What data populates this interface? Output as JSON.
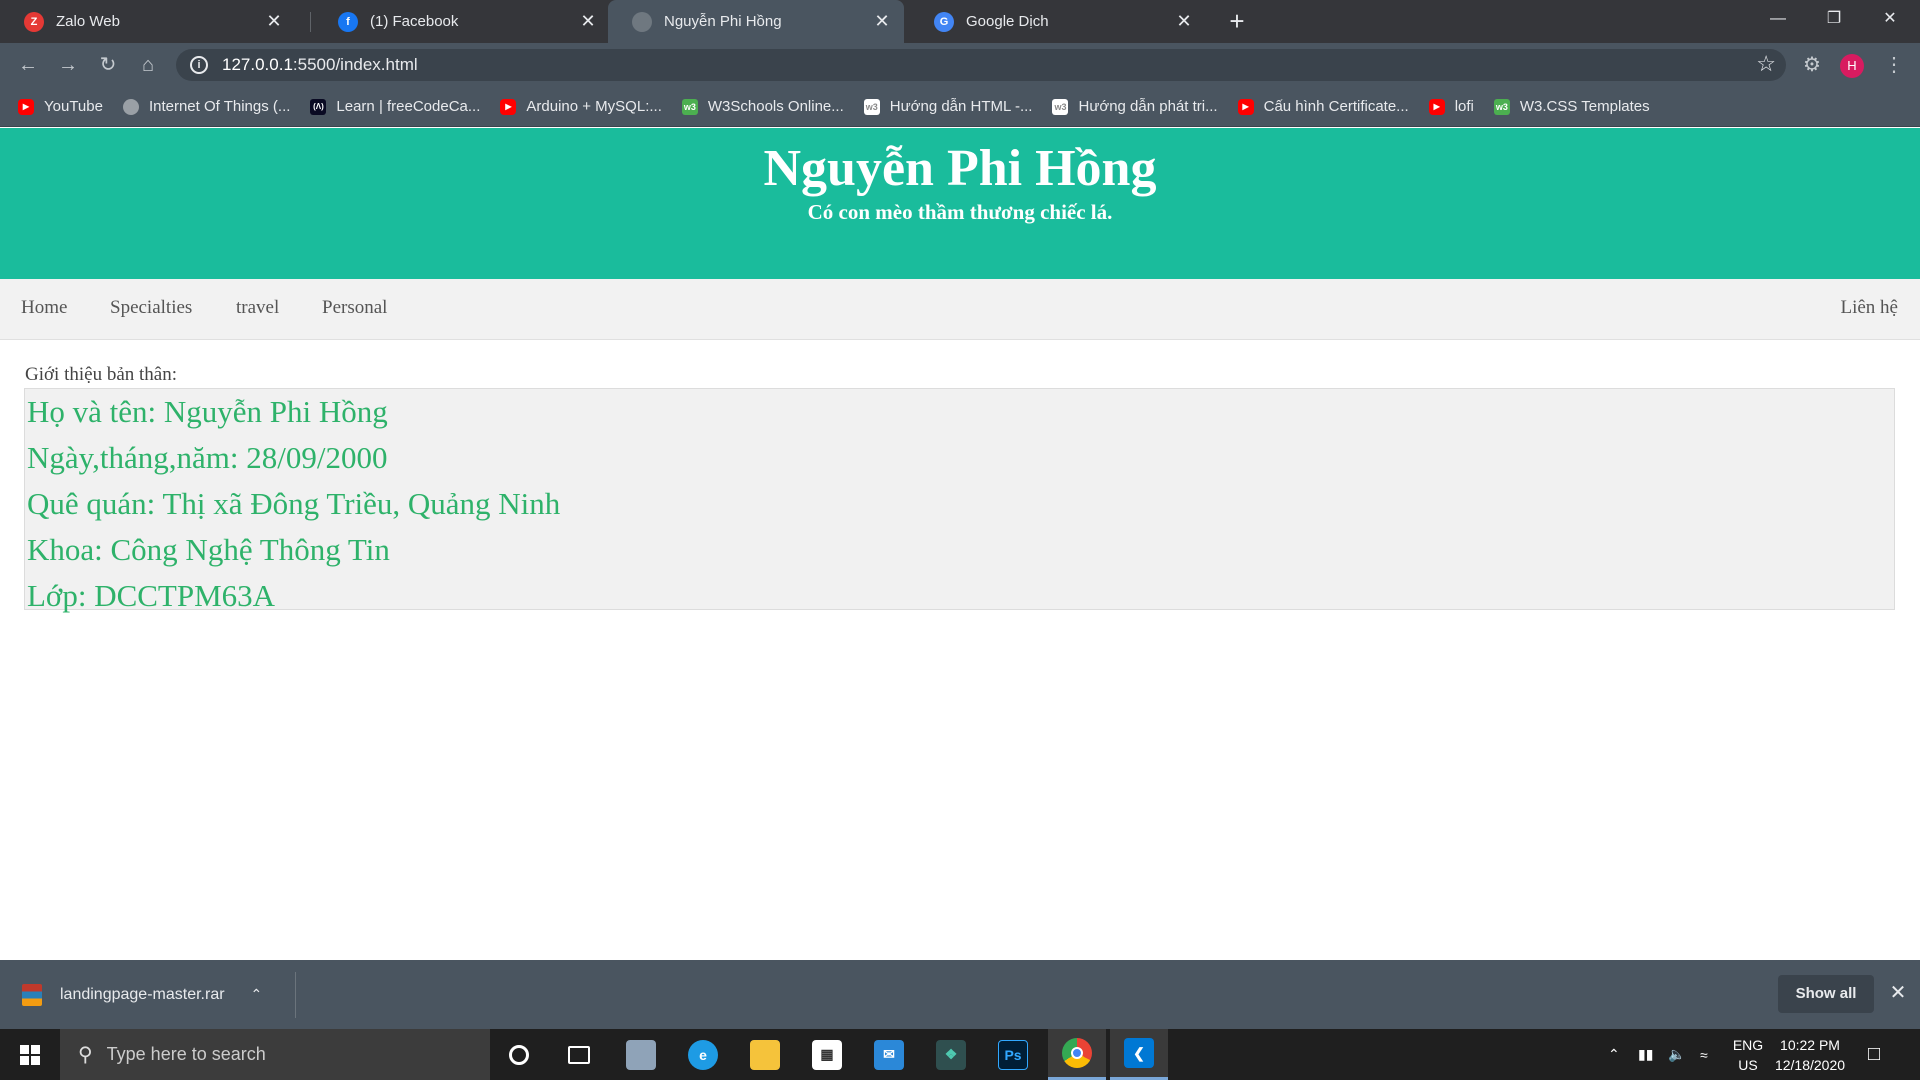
{
  "browser": {
    "tabs": [
      {
        "title": "Zalo Web",
        "icon": "zalo-icon",
        "color": "#e53935",
        "glyph": "Z"
      },
      {
        "title": "(1) Facebook",
        "icon": "facebook-icon",
        "color": "#1877f2",
        "glyph": "f"
      },
      {
        "title": "Nguyễn Phi Hồng",
        "icon": "globe-icon",
        "color": "#6f7880",
        "glyph": ""
      },
      {
        "title": "Google Dịch",
        "icon": "google-translate-icon",
        "color": "#4285f4",
        "glyph": "G"
      }
    ],
    "active_tab": 2,
    "url_host": "127.0.0.1",
    "url_rest": ":5500/index.html",
    "profile_initial": "H",
    "bookmarks": [
      {
        "label": "YouTube",
        "icon": "youtube-icon",
        "color": "#ff0000"
      },
      {
        "label": "Internet Of Things (...",
        "icon": "globe-icon",
        "color": "#9aa0a6"
      },
      {
        "label": "Learn | freeCodeCa...",
        "icon": "freecodecamp-icon",
        "color": "#0a0a23"
      },
      {
        "label": "Arduino + MySQL:...",
        "icon": "youtube-icon",
        "color": "#ff0000"
      },
      {
        "label": "W3Schools Online...",
        "icon": "w3schools-icon",
        "color": "#4caf50"
      },
      {
        "label": "Hướng dẫn HTML -...",
        "icon": "w3r-icon",
        "color": "#ffffff"
      },
      {
        "label": "Hướng dẫn phát tri...",
        "icon": "w3r-icon",
        "color": "#ffffff"
      },
      {
        "label": "Cấu hình Certificate...",
        "icon": "youtube-icon",
        "color": "#ff0000"
      },
      {
        "label": "lofi",
        "icon": "youtube-icon",
        "color": "#ff0000"
      },
      {
        "label": "W3.CSS Templates",
        "icon": "w3schools-icon",
        "color": "#4caf50"
      }
    ]
  },
  "page": {
    "title": "Nguyễn Phi Hồng",
    "subtitle": "Có con mèo thầm thương chiếc lá.",
    "header_color": "#1abc9c",
    "nav": [
      "Home",
      "Specialties",
      "travel",
      "Personal"
    ],
    "nav_right": "Liên hệ",
    "intro_label": "Giới thiệu bản thân:",
    "info": [
      "Họ và tên: Nguyễn Phi Hồng",
      "Ngày,tháng,năm: 28/09/2000",
      "Quê quán: Thị xã Đông Triều, Quảng Ninh",
      "Khoa: Công Nghệ Thông Tin",
      "Lớp: DCCTPM63A"
    ],
    "info_color": "#2eb26a"
  },
  "downloads": {
    "file": "landingpage-master.rar",
    "show_all": "Show all"
  },
  "taskbar": {
    "search_placeholder": "Type here to search",
    "lang_line1": "ENG",
    "lang_line2": "US",
    "time": "10:22 PM",
    "date": "12/18/2020"
  }
}
